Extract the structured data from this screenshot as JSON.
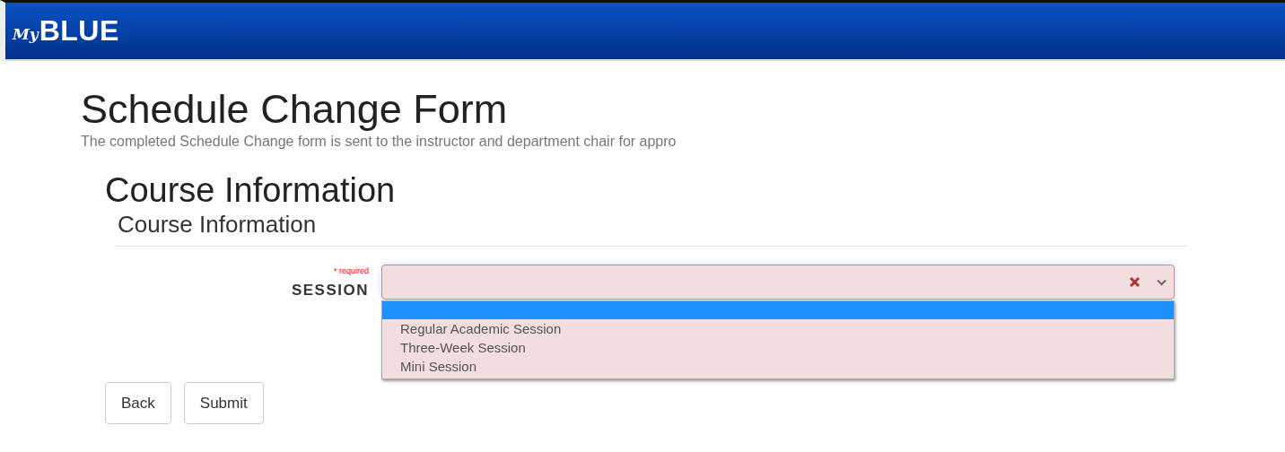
{
  "header": {
    "logo_prefix": "My",
    "logo_main": "BLUE"
  },
  "page": {
    "title": "Schedule Change Form",
    "description": "The completed Schedule Change form is sent to the instructor and department chair for appro"
  },
  "section": {
    "heading": "Course Information",
    "subheading": "Course Information"
  },
  "session_field": {
    "required_note": "* required",
    "label": "SESSION",
    "invalid": true,
    "expanded": true,
    "blank_option": {
      "selected": true
    },
    "options": [
      {
        "label": "Regular Academic Session",
        "selected": false
      },
      {
        "label": "Three-Week Session",
        "selected": false
      },
      {
        "label": "Mini Session",
        "selected": false
      }
    ]
  },
  "buttons": [
    "Back",
    "Submit"
  ]
}
